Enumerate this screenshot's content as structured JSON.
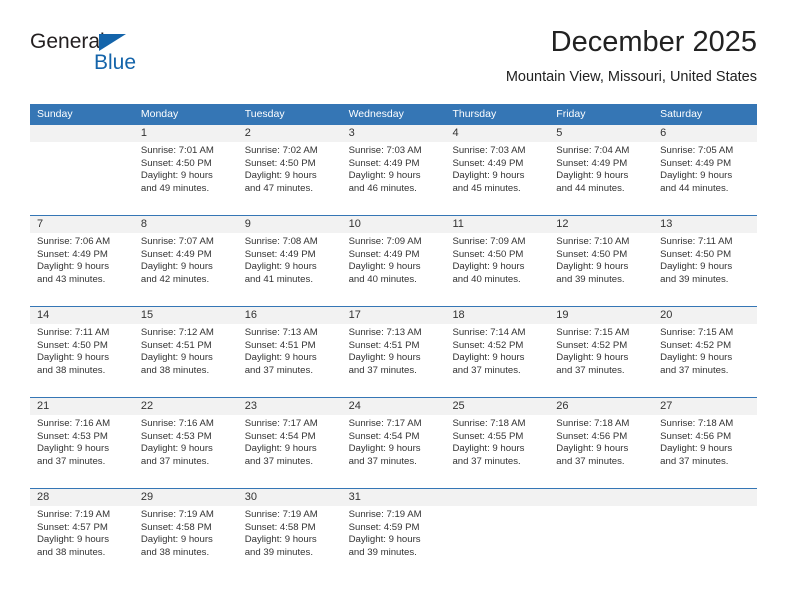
{
  "brand": {
    "name_part1": "General",
    "name_part2": "Blue",
    "accent_color": "#1464aa"
  },
  "header": {
    "month_title": "December 2025",
    "location": "Mountain View, Missouri, United States"
  },
  "calendar": {
    "header_color": "#3576b5",
    "day_names": [
      "Sunday",
      "Monday",
      "Tuesday",
      "Wednesday",
      "Thursday",
      "Friday",
      "Saturday"
    ],
    "weeks": [
      [
        {
          "day": "",
          "sunrise": "",
          "sunset": "",
          "daylight_1": "",
          "daylight_2": "",
          "empty": true
        },
        {
          "day": "1",
          "sunrise": "Sunrise: 7:01 AM",
          "sunset": "Sunset: 4:50 PM",
          "daylight_1": "Daylight: 9 hours",
          "daylight_2": "and 49 minutes."
        },
        {
          "day": "2",
          "sunrise": "Sunrise: 7:02 AM",
          "sunset": "Sunset: 4:50 PM",
          "daylight_1": "Daylight: 9 hours",
          "daylight_2": "and 47 minutes."
        },
        {
          "day": "3",
          "sunrise": "Sunrise: 7:03 AM",
          "sunset": "Sunset: 4:49 PM",
          "daylight_1": "Daylight: 9 hours",
          "daylight_2": "and 46 minutes."
        },
        {
          "day": "4",
          "sunrise": "Sunrise: 7:03 AM",
          "sunset": "Sunset: 4:49 PM",
          "daylight_1": "Daylight: 9 hours",
          "daylight_2": "and 45 minutes."
        },
        {
          "day": "5",
          "sunrise": "Sunrise: 7:04 AM",
          "sunset": "Sunset: 4:49 PM",
          "daylight_1": "Daylight: 9 hours",
          "daylight_2": "and 44 minutes."
        },
        {
          "day": "6",
          "sunrise": "Sunrise: 7:05 AM",
          "sunset": "Sunset: 4:49 PM",
          "daylight_1": "Daylight: 9 hours",
          "daylight_2": "and 44 minutes."
        }
      ],
      [
        {
          "day": "7",
          "sunrise": "Sunrise: 7:06 AM",
          "sunset": "Sunset: 4:49 PM",
          "daylight_1": "Daylight: 9 hours",
          "daylight_2": "and 43 minutes."
        },
        {
          "day": "8",
          "sunrise": "Sunrise: 7:07 AM",
          "sunset": "Sunset: 4:49 PM",
          "daylight_1": "Daylight: 9 hours",
          "daylight_2": "and 42 minutes."
        },
        {
          "day": "9",
          "sunrise": "Sunrise: 7:08 AM",
          "sunset": "Sunset: 4:49 PM",
          "daylight_1": "Daylight: 9 hours",
          "daylight_2": "and 41 minutes."
        },
        {
          "day": "10",
          "sunrise": "Sunrise: 7:09 AM",
          "sunset": "Sunset: 4:49 PM",
          "daylight_1": "Daylight: 9 hours",
          "daylight_2": "and 40 minutes."
        },
        {
          "day": "11",
          "sunrise": "Sunrise: 7:09 AM",
          "sunset": "Sunset: 4:50 PM",
          "daylight_1": "Daylight: 9 hours",
          "daylight_2": "and 40 minutes."
        },
        {
          "day": "12",
          "sunrise": "Sunrise: 7:10 AM",
          "sunset": "Sunset: 4:50 PM",
          "daylight_1": "Daylight: 9 hours",
          "daylight_2": "and 39 minutes."
        },
        {
          "day": "13",
          "sunrise": "Sunrise: 7:11 AM",
          "sunset": "Sunset: 4:50 PM",
          "daylight_1": "Daylight: 9 hours",
          "daylight_2": "and 39 minutes."
        }
      ],
      [
        {
          "day": "14",
          "sunrise": "Sunrise: 7:11 AM",
          "sunset": "Sunset: 4:50 PM",
          "daylight_1": "Daylight: 9 hours",
          "daylight_2": "and 38 minutes."
        },
        {
          "day": "15",
          "sunrise": "Sunrise: 7:12 AM",
          "sunset": "Sunset: 4:51 PM",
          "daylight_1": "Daylight: 9 hours",
          "daylight_2": "and 38 minutes."
        },
        {
          "day": "16",
          "sunrise": "Sunrise: 7:13 AM",
          "sunset": "Sunset: 4:51 PM",
          "daylight_1": "Daylight: 9 hours",
          "daylight_2": "and 37 minutes."
        },
        {
          "day": "17",
          "sunrise": "Sunrise: 7:13 AM",
          "sunset": "Sunset: 4:51 PM",
          "daylight_1": "Daylight: 9 hours",
          "daylight_2": "and 37 minutes."
        },
        {
          "day": "18",
          "sunrise": "Sunrise: 7:14 AM",
          "sunset": "Sunset: 4:52 PM",
          "daylight_1": "Daylight: 9 hours",
          "daylight_2": "and 37 minutes."
        },
        {
          "day": "19",
          "sunrise": "Sunrise: 7:15 AM",
          "sunset": "Sunset: 4:52 PM",
          "daylight_1": "Daylight: 9 hours",
          "daylight_2": "and 37 minutes."
        },
        {
          "day": "20",
          "sunrise": "Sunrise: 7:15 AM",
          "sunset": "Sunset: 4:52 PM",
          "daylight_1": "Daylight: 9 hours",
          "daylight_2": "and 37 minutes."
        }
      ],
      [
        {
          "day": "21",
          "sunrise": "Sunrise: 7:16 AM",
          "sunset": "Sunset: 4:53 PM",
          "daylight_1": "Daylight: 9 hours",
          "daylight_2": "and 37 minutes."
        },
        {
          "day": "22",
          "sunrise": "Sunrise: 7:16 AM",
          "sunset": "Sunset: 4:53 PM",
          "daylight_1": "Daylight: 9 hours",
          "daylight_2": "and 37 minutes."
        },
        {
          "day": "23",
          "sunrise": "Sunrise: 7:17 AM",
          "sunset": "Sunset: 4:54 PM",
          "daylight_1": "Daylight: 9 hours",
          "daylight_2": "and 37 minutes."
        },
        {
          "day": "24",
          "sunrise": "Sunrise: 7:17 AM",
          "sunset": "Sunset: 4:54 PM",
          "daylight_1": "Daylight: 9 hours",
          "daylight_2": "and 37 minutes."
        },
        {
          "day": "25",
          "sunrise": "Sunrise: 7:18 AM",
          "sunset": "Sunset: 4:55 PM",
          "daylight_1": "Daylight: 9 hours",
          "daylight_2": "and 37 minutes."
        },
        {
          "day": "26",
          "sunrise": "Sunrise: 7:18 AM",
          "sunset": "Sunset: 4:56 PM",
          "daylight_1": "Daylight: 9 hours",
          "daylight_2": "and 37 minutes."
        },
        {
          "day": "27",
          "sunrise": "Sunrise: 7:18 AM",
          "sunset": "Sunset: 4:56 PM",
          "daylight_1": "Daylight: 9 hours",
          "daylight_2": "and 37 minutes."
        }
      ],
      [
        {
          "day": "28",
          "sunrise": "Sunrise: 7:19 AM",
          "sunset": "Sunset: 4:57 PM",
          "daylight_1": "Daylight: 9 hours",
          "daylight_2": "and 38 minutes."
        },
        {
          "day": "29",
          "sunrise": "Sunrise: 7:19 AM",
          "sunset": "Sunset: 4:58 PM",
          "daylight_1": "Daylight: 9 hours",
          "daylight_2": "and 38 minutes."
        },
        {
          "day": "30",
          "sunrise": "Sunrise: 7:19 AM",
          "sunset": "Sunset: 4:58 PM",
          "daylight_1": "Daylight: 9 hours",
          "daylight_2": "and 39 minutes."
        },
        {
          "day": "31",
          "sunrise": "Sunrise: 7:19 AM",
          "sunset": "Sunset: 4:59 PM",
          "daylight_1": "Daylight: 9 hours",
          "daylight_2": "and 39 minutes."
        },
        {
          "day": "",
          "sunrise": "",
          "sunset": "",
          "daylight_1": "",
          "daylight_2": "",
          "empty": true
        },
        {
          "day": "",
          "sunrise": "",
          "sunset": "",
          "daylight_1": "",
          "daylight_2": "",
          "empty": true
        },
        {
          "day": "",
          "sunrise": "",
          "sunset": "",
          "daylight_1": "",
          "daylight_2": "",
          "empty": true
        }
      ]
    ]
  }
}
